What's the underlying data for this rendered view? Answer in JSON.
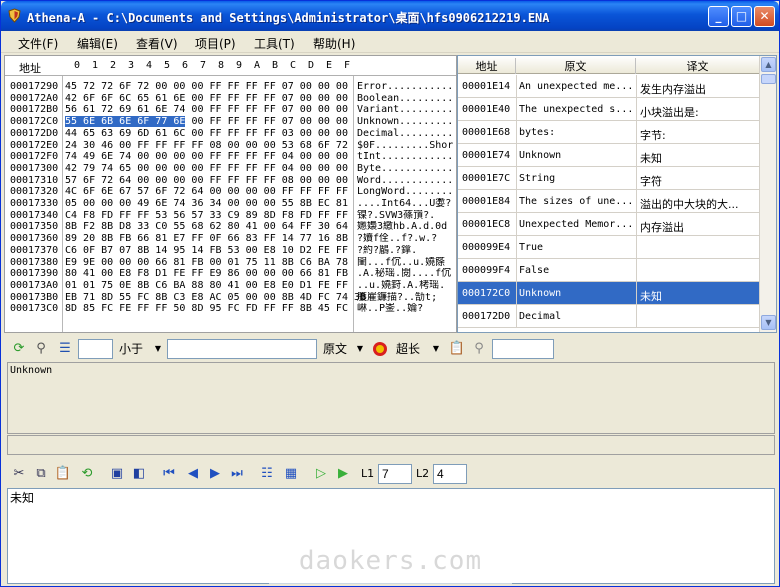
{
  "window": {
    "title": "Athena-A - C:\\Documents and Settings\\Administrator\\桌面\\hfs0906212219.ENA",
    "min_label": "_",
    "max_label": "□",
    "close_label": "✕"
  },
  "menu": {
    "items": [
      "文件(F)",
      "编辑(E)",
      "查看(V)",
      "项目(P)",
      "工具(T)",
      "帮助(H)"
    ]
  },
  "hex": {
    "address_header": "地址",
    "columns": [
      "0",
      "1",
      "2",
      "3",
      "4",
      "5",
      "6",
      "7",
      "8",
      "9",
      "A",
      "B",
      "C",
      "D",
      "E",
      "F"
    ],
    "rows": [
      {
        "addr": "00017290",
        "hex": "45 72 72 6F 72 00 00 00 FF FF FF FF 07 00 00 00",
        "text": "Error..........."
      },
      {
        "addr": "000172A0",
        "hex": "42 6F 6F 6C 65 61 6E 00 FF FF FF FF 07 00 00 00",
        "text": "Boolean........."
      },
      {
        "addr": "000172B0",
        "hex": "56 61 72 69 61 6E 74 00 FF FF FF FF 07 00 00 00",
        "text": "Variant........."
      },
      {
        "addr": "000172C0",
        "hex_sel": "55 6E 6B 6E 6F 77 6E",
        "hex": " 00 FF FF FF FF 07 00 00 00",
        "text": "Unknown........."
      },
      {
        "addr": "000172D0",
        "hex": "44 65 63 69 6D 61 6C 00 FF FF FF FF 03 00 00 00",
        "text": "Decimal........."
      },
      {
        "addr": "000172E0",
        "hex": "24 30 46 00 FF FF FF FF 08 00 00 00 53 68 6F 72",
        "text": "$0F.........Shor"
      },
      {
        "addr": "000172F0",
        "hex": "74 49 6E 74 00 00 00 00 FF FF FF FF 04 00 00 00",
        "text": "tInt............"
      },
      {
        "addr": "00017300",
        "hex": "42 79 74 65 00 00 00 00 FF FF FF FF 04 00 00 00",
        "text": "Byte............"
      },
      {
        "addr": "00017310",
        "hex": "57 6F 72 64 00 00 00 00 FF FF FF FF 08 00 00 00",
        "text": "Word............"
      },
      {
        "addr": "00017320",
        "hex": "4C 6F 6E 67 57 6F 72 64 00 00 00 00 FF FF FF FF",
        "text": "LongWord........"
      },
      {
        "addr": "00017330",
        "hex": "05 00 00 00 49 6E 74 36 34 00 00 00 55 8B EC 81",
        "text": "....Int64...U嬱?"
      },
      {
        "addr": "00017340",
        "hex": "C4 F8 FD FF FF 53 56 57 33 C9 89 8D F8 FD FF FF",
        "text": "镍?.SVW3蓧嵿?."
      },
      {
        "addr": "00017350",
        "hex": "8B F2 8B D8 33 C0 55 68 62 80 41 00 64 FF 30 64",
        "text": "嬺嬝3繳hb.A.d.0d"
      },
      {
        "addr": "00017360",
        "hex": "89 20 8B FB 66 81 E7 FF 0F 66 83 FF 14 77 16 8B",
        "text": "?嬻f佺..f?.w.?"
      },
      {
        "addr": "00017370",
        "hex": "C6 0F B7 07 8B 14 95 14 FB 53 00 E8 10 D2 FE FF",
        "text": "?約?鶞.?鎿."
      },
      {
        "addr": "00017380",
        "hex": "E9 9E 00 00 00 66 81 FB 00 01 75 11 8B C6 BA 78",
        "text": "闉...f伔..u.嬈篨"
      },
      {
        "addr": "00017390",
        "hex": "80 41 00 E8 F8 D1 FE FF E9 86 00 00 00 66 81 FB",
        "text": ".A.秘瑶.閱....f伔"
      },
      {
        "addr": "000173A0",
        "hex": "01 01 75 0E 8B C6 BA 88 80 41 00 E8 E0 D1 FE FF",
        "text": "..u.嬈篈.A.栲瑶."
      },
      {
        "addr": "000173B0",
        "hex": "EB 71 8D 55 FC 8B C3 E8 AC 05 00 00 8B 4D FC 74 3B",
        "text": "雘嵟鐮描?..勂t;"
      },
      {
        "addr": "000173C0",
        "hex": "8D 85 FC FE FF FF 50 8D 95 FC FD FF FF 8B 45 FC",
        "text": "崊..P崟..婨?"
      }
    ]
  },
  "grid": {
    "headers": [
      "地址",
      "原文",
      "译文"
    ],
    "rows": [
      {
        "addr": "00001E14",
        "orig": "An unexpected me...",
        "trans": "发生内存溢出",
        "selected": false
      },
      {
        "addr": "00001E40",
        "orig": "The unexpected s...",
        "trans": "小块溢出是:",
        "selected": false
      },
      {
        "addr": "00001E68",
        "orig": " bytes:",
        "trans": "字节:",
        "selected": false
      },
      {
        "addr": "00001E74",
        "orig": "Unknown",
        "trans": "未知",
        "selected": false
      },
      {
        "addr": "00001E7C",
        "orig": "String",
        "trans": "字符",
        "selected": false
      },
      {
        "addr": "00001E84",
        "orig": "The sizes of une...",
        "trans": "溢出的中大块的大...",
        "selected": false
      },
      {
        "addr": "00001EC8",
        "orig": "Unexpected Memor...",
        "trans": "内存溢出",
        "selected": false
      },
      {
        "addr": "000099E4",
        "orig": "True",
        "trans": "",
        "selected": false
      },
      {
        "addr": "000099F4",
        "orig": "False",
        "trans": "",
        "selected": false
      },
      {
        "addr": "000172C0",
        "orig": "Unknown",
        "trans": "未知",
        "selected": true
      },
      {
        "addr": "000172D0",
        "orig": "Decimal",
        "trans": "",
        "selected": false
      }
    ]
  },
  "toolbar1": {
    "num_value": "",
    "compare_label": "小于",
    "search_value": "",
    "field_label": "原文",
    "length_label": "超长",
    "filter_value": ""
  },
  "info": {
    "original_text": "Unknown",
    "status_text": ""
  },
  "toolbar2": {
    "l1_label": "L1",
    "l1_value": "7",
    "l2_label": "L2",
    "l2_value": "4"
  },
  "translation": {
    "text": "未知"
  },
  "watermark": "daokers.com",
  "colors": {
    "title_blue": "#0a55d8",
    "selection_blue": "#316ac5",
    "face": "#ece9d8"
  }
}
